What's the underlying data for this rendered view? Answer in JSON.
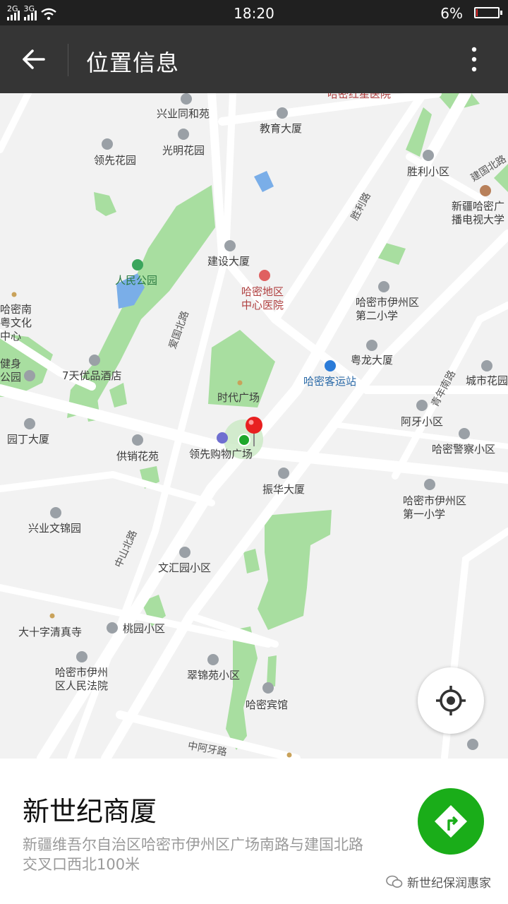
{
  "status": {
    "net1": "2G",
    "net2": "3G",
    "time": "18:20",
    "battery_pct": "6%",
    "battery_level": 0.06
  },
  "appbar": {
    "title": "位置信息"
  },
  "map": {
    "pois": [
      "兴业同和苑",
      "教育大厦",
      "光明花园",
      "领先花园",
      "胜利小区",
      "建设大厦",
      "人民公园",
      "哈密地区中心医院",
      "哈密市伊州区第二小学",
      "粤龙大厦",
      "哈密客运站",
      "城市花园",
      "7天优品酒店",
      "时代广场",
      "领先购物广场",
      "阿牙小区",
      "园丁大厦",
      "供销花苑",
      "哈密警察小区",
      "振华大厦",
      "哈密市伊州区第一小学",
      "兴业文锦园",
      "文汇园小区",
      "大十字清真寺",
      "桃园小区",
      "翠锦苑小区",
      "哈密市伊州区人民法院",
      "哈密宾馆",
      "新疆哈密广播电视大学",
      "哈密南粤文化中心",
      "健身公园",
      "哈密红星医院"
    ],
    "roads": [
      "建国北路",
      "胜利路",
      "爱国北路",
      "青年南路",
      "中山北路",
      "中阿牙路"
    ]
  },
  "place": {
    "name": "新世纪商厦",
    "address": "新疆维吾尔自治区哈密市伊州区广场南路与建国北路交叉口西北100米"
  },
  "watermark": "新世纪保润惠家",
  "colors": {
    "accent": "#1aad19",
    "park": "#a8dea0",
    "water": "#7aaee8",
    "pin": "#e82020"
  }
}
